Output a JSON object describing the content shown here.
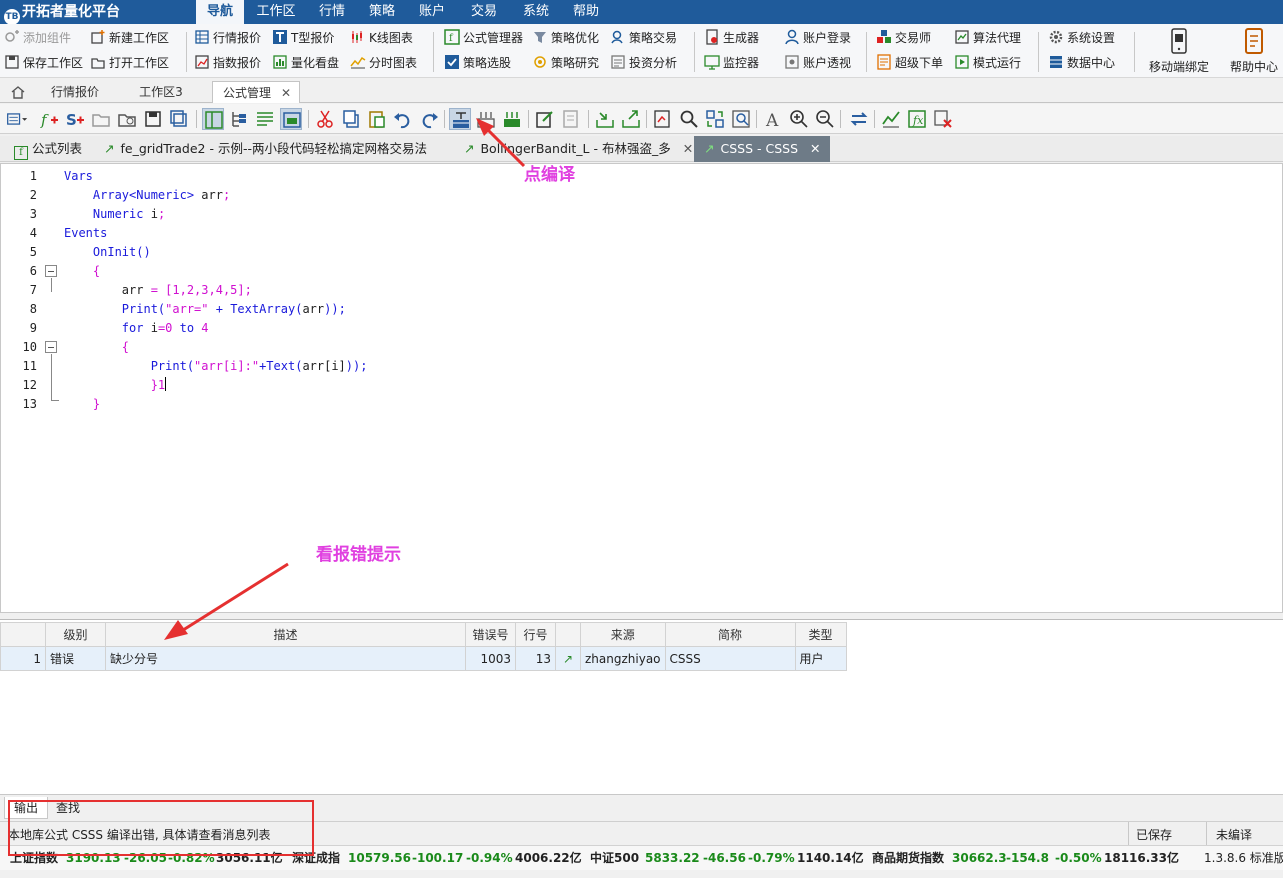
{
  "app": {
    "title": "开拓者量化平台",
    "logo_text": "TB"
  },
  "menu": [
    "导航",
    "工作区",
    "行情",
    "策略",
    "账户",
    "交易",
    "系统",
    "帮助"
  ],
  "ribbon": {
    "col1": [
      "添加组件",
      "保存工作区"
    ],
    "col2": [
      "新建工作区",
      "打开工作区"
    ],
    "col3": [
      "行情报价",
      "指数报价"
    ],
    "col4": [
      "T型报价",
      "量化看盘"
    ],
    "col5": [
      "K线图表",
      "分时图表"
    ],
    "col6": [
      "公式管理器",
      "策略选股"
    ],
    "col7": [
      "策略优化",
      "策略研究"
    ],
    "col8": [
      "策略交易",
      "投资分析"
    ],
    "col9": [
      "生成器",
      "监控器"
    ],
    "col10": [
      "账户登录",
      "账户透视"
    ],
    "col11": [
      "交易师",
      "超级下单"
    ],
    "col12": [
      "算法代理",
      "模式运行"
    ],
    "col13": [
      "系统设置",
      "数据中心"
    ],
    "big1": "移动端绑定",
    "big2": "帮助中心"
  },
  "work_tabs": [
    "行情报价",
    "工作区3",
    "公式管理"
  ],
  "formula_tabs": [
    {
      "label": "公式列表"
    },
    {
      "label": "fe_gridTrade2 - 示例--两小段代码轻松搞定网格交易法"
    },
    {
      "label": "BollingerBandit_L - 布林强盗_多"
    },
    {
      "label": "CSSS - CSSS"
    }
  ],
  "annotations": {
    "compile_hint": "点编译",
    "error_hint": "看报错提示"
  },
  "code": {
    "line_numbers": [
      "1",
      "2",
      "3",
      "4",
      "5",
      "6",
      "7",
      "8",
      "9",
      "10",
      "11",
      "12",
      "13"
    ],
    "lines": [
      [
        {
          "t": "Vars",
          "c": "kw"
        }
      ],
      [
        {
          "t": "    Array<Numeric>",
          "c": "kw"
        },
        {
          "t": " arr",
          "c": "tx"
        },
        {
          "t": ";",
          "c": "pk"
        }
      ],
      [
        {
          "t": "    Numeric",
          "c": "kw"
        },
        {
          "t": " i",
          "c": "tx"
        },
        {
          "t": ";",
          "c": "pk"
        }
      ],
      [
        {
          "t": "Events",
          "c": "kw"
        }
      ],
      [
        {
          "t": "    OnInit()",
          "c": "kw"
        }
      ],
      [
        {
          "t": "    {",
          "c": "pk"
        }
      ],
      [
        {
          "t": "        arr",
          "c": "tx"
        },
        {
          "t": " = [1,2,3,4,5];",
          "c": "pk"
        }
      ],
      [
        {
          "t": "        Print(",
          "c": "kw"
        },
        {
          "t": "\"arr=\"",
          "c": "pk"
        },
        {
          "t": " + TextArray(",
          "c": "kw"
        },
        {
          "t": "arr",
          "c": "tx"
        },
        {
          "t": "));",
          "c": "kw"
        }
      ],
      [
        {
          "t": "        for",
          "c": "kw"
        },
        {
          "t": " i",
          "c": "tx"
        },
        {
          "t": "=0 ",
          "c": "pk"
        },
        {
          "t": "to",
          "c": "kw"
        },
        {
          "t": " 4",
          "c": "pk"
        }
      ],
      [
        {
          "t": "        {",
          "c": "pk"
        }
      ],
      [
        {
          "t": "            Print(",
          "c": "kw"
        },
        {
          "t": "\"arr[i]:\"",
          "c": "pk"
        },
        {
          "t": "+Text(",
          "c": "kw"
        },
        {
          "t": "arr[i]",
          "c": "tx"
        },
        {
          "t": "));",
          "c": "kw"
        }
      ],
      [
        {
          "t": "            }1",
          "c": "pk"
        }
      ],
      [
        {
          "t": "    }",
          "c": "pk"
        }
      ]
    ]
  },
  "error_table": {
    "headers": [
      "",
      "级别",
      "描述",
      "错误号",
      "行号",
      "",
      "来源",
      "简称",
      "类型"
    ],
    "rows": [
      {
        "index": "1",
        "level": "错误",
        "desc": "缺少分号",
        "code": "1003",
        "line": "13",
        "source": "zhangzhiyao",
        "short": "CSSS",
        "type": "用户"
      }
    ]
  },
  "output_tabs": [
    "输出",
    "查找"
  ],
  "status": {
    "message": "本地库公式 CSSS 编译出错, 具体请查看消息列表",
    "saved": "已保存",
    "compiled": "未编译"
  },
  "ticker": [
    {
      "name": "上证指数",
      "price": "3190.13",
      "chg": "-26.05",
      "pct": "-0.82%",
      "amt": "3056.11亿"
    },
    {
      "name": "深证成指",
      "price": "10579.56",
      "chg": "-100.17",
      "pct": "-0.94%",
      "amt": "4006.22亿"
    },
    {
      "name": "中证500",
      "price": "5833.22",
      "chg": "-46.56",
      "pct": "-0.79%",
      "amt": "1140.14亿"
    },
    {
      "name": "商品期货指数",
      "price": "30662.3",
      "chg": "-154.8",
      "pct": "-0.50%",
      "amt": "18116.33亿"
    }
  ],
  "version": "1.3.8.6 标准版",
  "colors": {
    "title_bar": "#1f5b9b",
    "accent_pink": "#e040e0",
    "annotation_box": "#e53030",
    "down_green": "#1a8a1a"
  }
}
